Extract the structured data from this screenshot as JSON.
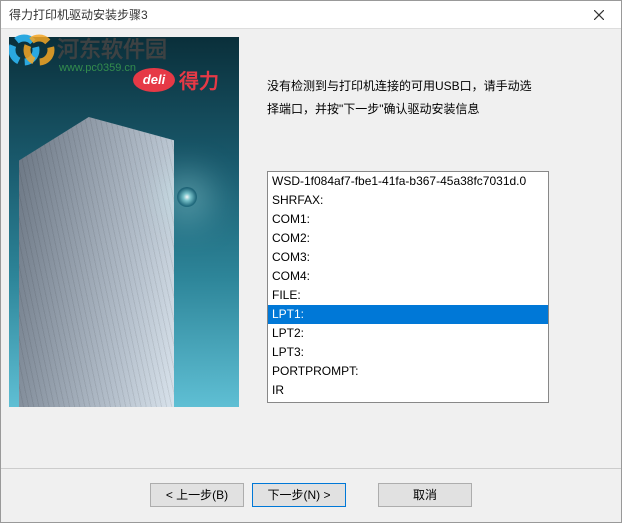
{
  "window": {
    "title": "得力打印机驱动安装步骤3"
  },
  "watermark": {
    "site": "河东软件园",
    "url": "www.pc0359.cn"
  },
  "brand": {
    "logo_en": "deli",
    "logo_cn": "得力"
  },
  "instruction": {
    "line1": "没有检测到与打印机连接的可用USB口，请手动选",
    "line2": "择端口，并按\"下一步\"确认驱动安装信息"
  },
  "ports": [
    {
      "name": "WSD-1f084af7-fbe1-41fa-b367-45a38fc7031d.0",
      "selected": false
    },
    {
      "name": "SHRFAX:",
      "selected": false
    },
    {
      "name": "COM1:",
      "selected": false
    },
    {
      "name": "COM2:",
      "selected": false
    },
    {
      "name": "COM3:",
      "selected": false
    },
    {
      "name": "COM4:",
      "selected": false
    },
    {
      "name": "FILE:",
      "selected": false
    },
    {
      "name": "LPT1:",
      "selected": true
    },
    {
      "name": "LPT2:",
      "selected": false
    },
    {
      "name": "LPT3:",
      "selected": false
    },
    {
      "name": "PORTPROMPT:",
      "selected": false
    },
    {
      "name": "IR",
      "selected": false
    }
  ],
  "buttons": {
    "back": "< 上一步(B)",
    "next": "下一步(N) >",
    "cancel": "取消"
  }
}
